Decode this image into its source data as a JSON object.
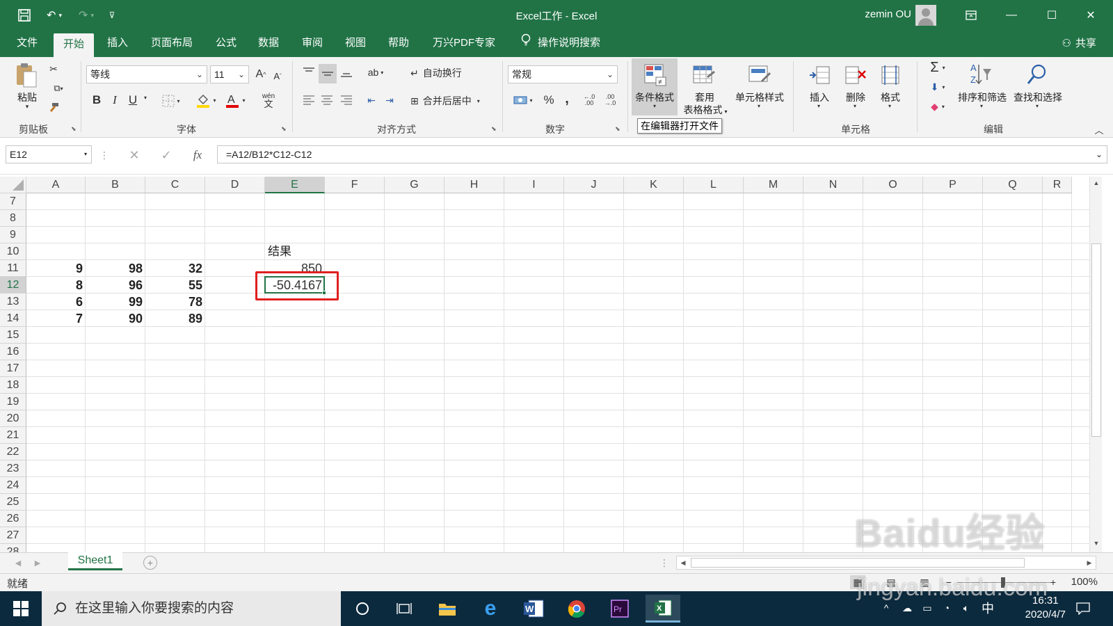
{
  "window": {
    "title": "Excel工作  -  Excel",
    "user": "zemin OU"
  },
  "colors": {
    "brand": "#217346",
    "annotation": "#e02020"
  },
  "tabs": [
    {
      "label": "文件"
    },
    {
      "label": "开始"
    },
    {
      "label": "插入"
    },
    {
      "label": "页面布局"
    },
    {
      "label": "公式"
    },
    {
      "label": "数据"
    },
    {
      "label": "审阅"
    },
    {
      "label": "视图"
    },
    {
      "label": "帮助"
    },
    {
      "label": "万兴PDF专家"
    },
    {
      "label": "操作说明搜索"
    }
  ],
  "share": "共享",
  "ribbon": {
    "clipboard": {
      "label": "剪贴板",
      "paste": "粘贴"
    },
    "font": {
      "label": "字体",
      "name": "等线",
      "size": "11",
      "bold": "B",
      "italic": "I",
      "underline": "U",
      "phonetic_top": "wén",
      "phonetic_bottom": "文"
    },
    "align": {
      "label": "对齐方式",
      "wrap": "自动换行",
      "merge": "合并后居中"
    },
    "number": {
      "label": "数字",
      "format": "常规",
      "percent": "%",
      "comma": ","
    },
    "styles": {
      "conditional": "条件格式",
      "table_line1": "套用",
      "table_line2": "表格格式",
      "cell_styles": "单元格样式"
    },
    "cells": {
      "label": "单元格",
      "insert": "插入",
      "delete": "删除",
      "format": "格式"
    },
    "editing": {
      "label": "编辑",
      "sort": "排序和筛选",
      "find": "查找和选择"
    },
    "tooltip": "在编辑器打开文件"
  },
  "formula_bar": {
    "name_box": "E12",
    "formula": "=A12/B12*C12-C12",
    "fx": "fx"
  },
  "columns": [
    "A",
    "B",
    "C",
    "D",
    "E",
    "F",
    "G",
    "H",
    "I",
    "J",
    "K",
    "L",
    "M",
    "N",
    "O",
    "P",
    "Q",
    "R"
  ],
  "rows": [
    "7",
    "8",
    "9",
    "10",
    "11",
    "12",
    "13",
    "14",
    "15",
    "16",
    "17",
    "18",
    "19",
    "20",
    "21",
    "22",
    "23",
    "24",
    "25",
    "26",
    "27",
    "28"
  ],
  "cells": {
    "E10": "结果",
    "A11": "9",
    "B11": "98",
    "C11": "32",
    "E11": "850",
    "A12": "8",
    "B12": "96",
    "C12": "55",
    "E12": "-50.4167",
    "A13": "6",
    "B13": "99",
    "C13": "78",
    "A14": "7",
    "B14": "90",
    "C14": "89"
  },
  "sheet_tab": "Sheet1",
  "status": {
    "ready": "就绪",
    "zoom": "100%"
  },
  "taskbar": {
    "search_placeholder": "在这里输入你要搜索的内容",
    "ime": "中",
    "time": "16:31",
    "date": "2020/4/7"
  },
  "watermark": {
    "line1": "Baidu经验",
    "line2": "jingyan.baidu.com"
  }
}
